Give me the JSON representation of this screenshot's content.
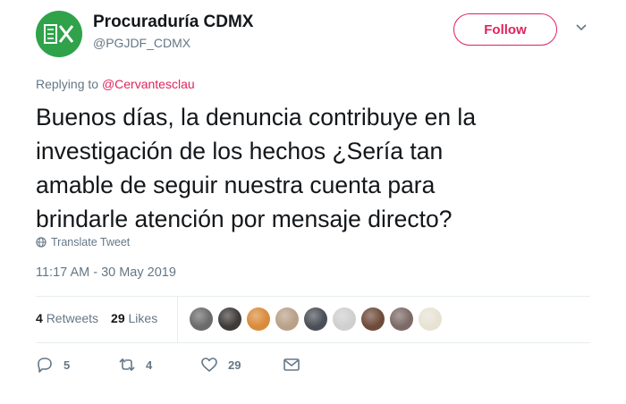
{
  "account": {
    "name": "Procuraduría CDMX",
    "handle": "@PGJDF_CDMX",
    "brand_color": "#2fa24a"
  },
  "follow_label": "Follow",
  "replying": {
    "prefix": "Replying to",
    "mention": "@Cervantesclau"
  },
  "text_lines": [
    "Buenos días, la denuncia contribuye en la",
    "investigación de los hechos ¿Sería tan",
    "amable de seguir nuestra cuenta para",
    "brindarle atención por mensaje directo?"
  ],
  "translate_label": "Translate Tweet",
  "timestamp": "11:17 AM - 30 May 2019",
  "stats": {
    "retweets_count": "4",
    "retweets_label": "Retweets",
    "likes_count": "29",
    "likes_label": "Likes"
  },
  "likers": [
    {
      "icon": "liker-avatar",
      "color": "#6b6b6b"
    },
    {
      "icon": "liker-avatar",
      "color": "#3e3a38"
    },
    {
      "icon": "liker-avatar",
      "color": "#d98b3a"
    },
    {
      "icon": "liker-avatar",
      "color": "#b9a088"
    },
    {
      "icon": "liker-avatar",
      "color": "#4a4f57"
    },
    {
      "icon": "liker-avatar",
      "color": "#cfcfcf"
    },
    {
      "icon": "liker-avatar",
      "color": "#6e4b3a"
    },
    {
      "icon": "liker-avatar",
      "color": "#7c6a66"
    },
    {
      "icon": "liker-avatar",
      "color": "#e8e2d4"
    }
  ],
  "actions": {
    "reply_count": "5",
    "retweet_count": "4",
    "like_count": "29"
  },
  "colors": {
    "accent": "#e0245e",
    "muted": "#657786",
    "text": "#14171a"
  }
}
